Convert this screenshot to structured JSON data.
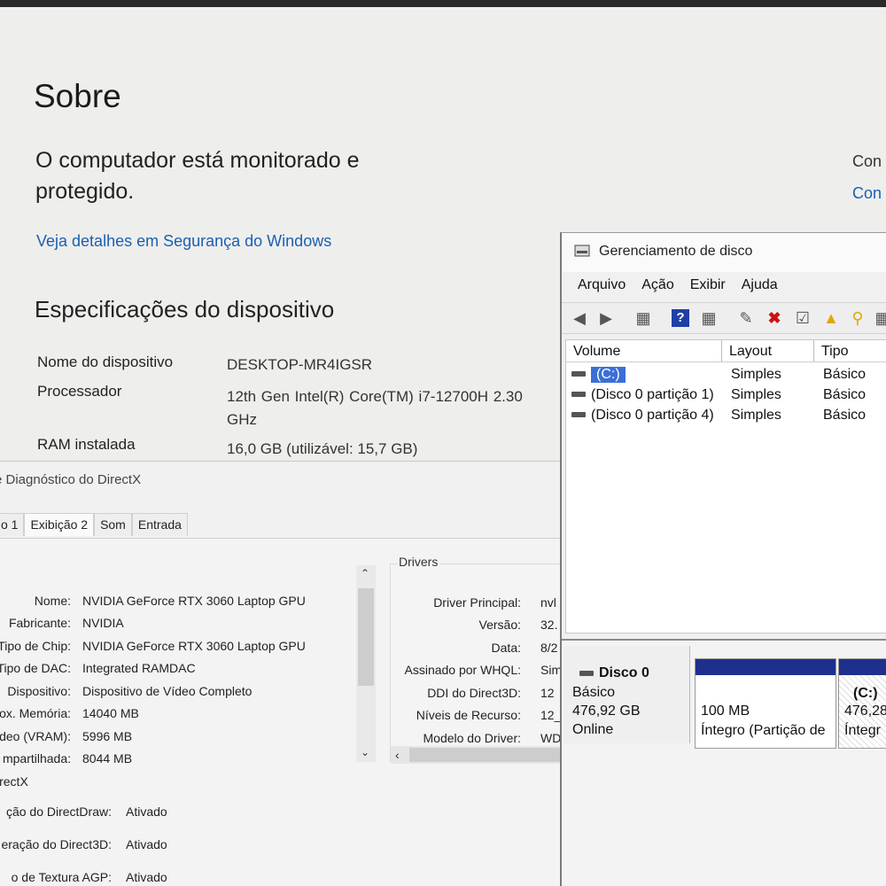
{
  "settings": {
    "title": "Sobre",
    "protection_text": "O computador está monitorado e protegido.",
    "right_links": [
      "Con",
      "Con"
    ],
    "security_link": "Veja detalhes em Segurança do Windows",
    "specs_title": "Especificações do dispositivo",
    "specs": [
      {
        "label": "Nome do dispositivo",
        "value": "DESKTOP-MR4IGSR"
      },
      {
        "label": "Processador",
        "value": "12th Gen Intel(R) Core(TM) i7-12700H   2.30 GHz"
      },
      {
        "label": "RAM instalada",
        "value": "16,0 GB (utilizável: 15,7 GB)"
      }
    ]
  },
  "directx": {
    "title": "e Diagnóstico do DirectX",
    "tabs": [
      "o 1",
      "Exibição 2",
      "Som",
      "Entrada"
    ],
    "device": [
      {
        "label": "Nome:",
        "value": "NVIDIA GeForce RTX 3060 Laptop GPU"
      },
      {
        "label": "Fabricante:",
        "value": "NVIDIA"
      },
      {
        "label": "Tipo de Chip:",
        "value": "NVIDIA GeForce RTX 3060 Laptop GPU"
      },
      {
        "label": "Tipo de DAC:",
        "value": "Integrated RAMDAC"
      },
      {
        "label": "Dispositivo:",
        "value": "Dispositivo de Vídeo Completo"
      },
      {
        "label": "ox. Memória:",
        "value": "14040 MB"
      },
      {
        "label": "deo (VRAM):",
        "value": "5996 MB"
      },
      {
        "label": "mpartilhada:",
        "value": "8044 MB"
      }
    ],
    "drivers_heading": "Drivers",
    "drivers": [
      {
        "label": "Driver Principal:",
        "value": "nvl"
      },
      {
        "label": "Versão:",
        "value": "32."
      },
      {
        "label": "Data:",
        "value": "8/2"
      },
      {
        "label": "Assinado por WHQL:",
        "value": "Sim"
      },
      {
        "label": "DDI do Direct3D:",
        "value": "12"
      },
      {
        "label": "Níveis de Recurso:",
        "value": "12_"
      },
      {
        "label": "Modelo do Driver:",
        "value": "WD"
      }
    ],
    "section_label": "irectX",
    "features": [
      {
        "label": "ção do DirectDraw:",
        "value": "Ativado"
      },
      {
        "label": "eração do Direct3D:",
        "value": "Ativado"
      },
      {
        "label": "o de Textura AGP:",
        "value": "Ativado"
      }
    ]
  },
  "disk_mgmt": {
    "title": "Gerenciamento de disco",
    "menu": [
      "Arquivo",
      "Ação",
      "Exibir",
      "Ajuda"
    ],
    "columns": [
      "Volume",
      "Layout",
      "Tipo"
    ],
    "volumes": [
      {
        "name": "(C:)",
        "layout": "Simples",
        "tipo": "Básico"
      },
      {
        "name": "(Disco 0 partição 1)",
        "layout": "Simples",
        "tipo": "Básico"
      },
      {
        "name": "(Disco 0 partição 4)",
        "layout": "Simples",
        "tipo": "Básico"
      }
    ],
    "disk": {
      "name": "Disco 0",
      "type": "Básico",
      "size": "476,92 GB",
      "status": "Online"
    },
    "partitions": [
      {
        "size": "100 MB",
        "status": "Íntegro (Partição de"
      },
      {
        "label": "(C:)",
        "size": "476,28",
        "status": "Íntegr"
      }
    ]
  }
}
